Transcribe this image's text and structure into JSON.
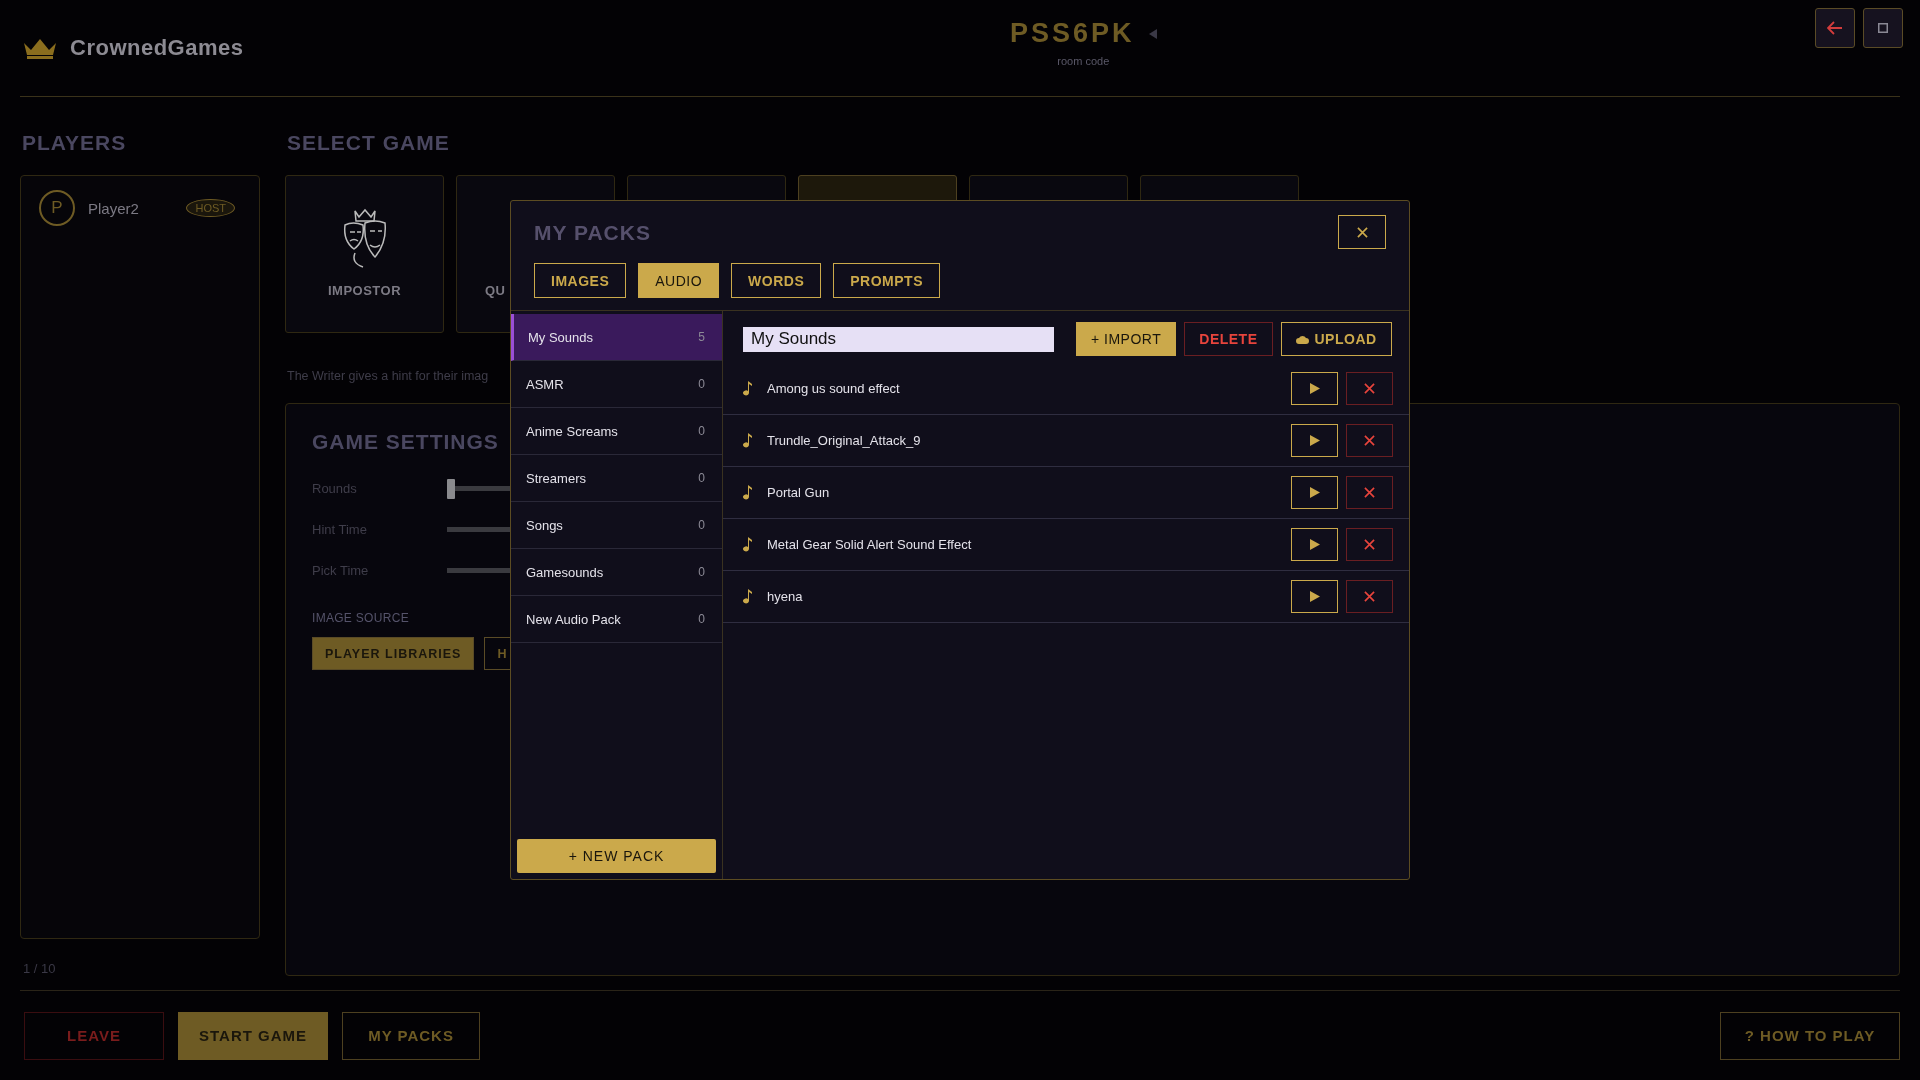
{
  "header": {
    "logo_text": "CrownedGames",
    "room_code": "PSS6PK",
    "room_code_label": "room code"
  },
  "players": {
    "title": "PLAYERS",
    "list": [
      {
        "initial": "P",
        "name": "Player2",
        "badge": "HOST"
      }
    ],
    "count": "1 / 10"
  },
  "select_game": {
    "title": "SELECT GAME",
    "games": [
      {
        "label": "IMPOSTOR",
        "selected": false
      },
      {
        "label": "QU",
        "selected": false
      },
      {
        "selected": false
      },
      {
        "selected": true
      },
      {
        "selected": false
      },
      {
        "selected": false
      }
    ],
    "description": "The Writer gives a hint for their imag"
  },
  "game_settings": {
    "title": "GAME SETTINGS",
    "sliders": [
      {
        "label": "Rounds",
        "level": 0
      },
      {
        "label": "Hint Time"
      },
      {
        "label": "Pick Time"
      }
    ],
    "image_source": {
      "label": "IMAGE SOURCE",
      "options": [
        {
          "label": "PLAYER LIBRARIES",
          "selected": true
        },
        {
          "label": "H",
          "selected": false
        }
      ]
    }
  },
  "footer": {
    "buttons": [
      {
        "label": "LEAVE",
        "kind": "danger"
      },
      {
        "label": "START GAME",
        "kind": "primary"
      },
      {
        "label": "MY PACKS",
        "kind": "outline"
      }
    ],
    "help": "? HOW TO PLAY"
  },
  "modal": {
    "title": "MY PACKS",
    "tabs": [
      {
        "label": "IMAGES",
        "selected": false
      },
      {
        "label": "AUDIO",
        "selected": true
      },
      {
        "label": "WORDS",
        "selected": false
      },
      {
        "label": "PROMPTS",
        "selected": false
      }
    ],
    "packs": [
      {
        "name": "My Sounds",
        "count": "5",
        "selected": true
      },
      {
        "name": "ASMR",
        "count": "0",
        "selected": false
      },
      {
        "name": "Anime Screams",
        "count": "0",
        "selected": false
      },
      {
        "name": "Streamers",
        "count": "0",
        "selected": false
      },
      {
        "name": "Songs",
        "count": "0",
        "selected": false
      },
      {
        "name": "Gamesounds",
        "count": "0",
        "selected": false
      },
      {
        "name": "New Audio Pack",
        "count": "0",
        "selected": false
      }
    ],
    "new_pack": "+ NEW PACK",
    "pack_name": "My Sounds",
    "actions": [
      {
        "label": "+ IMPORT",
        "kind": "primary"
      },
      {
        "label": "DELETE",
        "kind": "danger"
      },
      {
        "label": "UPLOAD",
        "kind": "upload"
      }
    ],
    "sounds": [
      {
        "name": "Among us sound effect"
      },
      {
        "name": "Trundle_Original_Attack_9"
      },
      {
        "name": "Portal Gun"
      },
      {
        "name": "Metal Gear Solid Alert Sound Effect"
      },
      {
        "name": "hyena"
      }
    ]
  }
}
